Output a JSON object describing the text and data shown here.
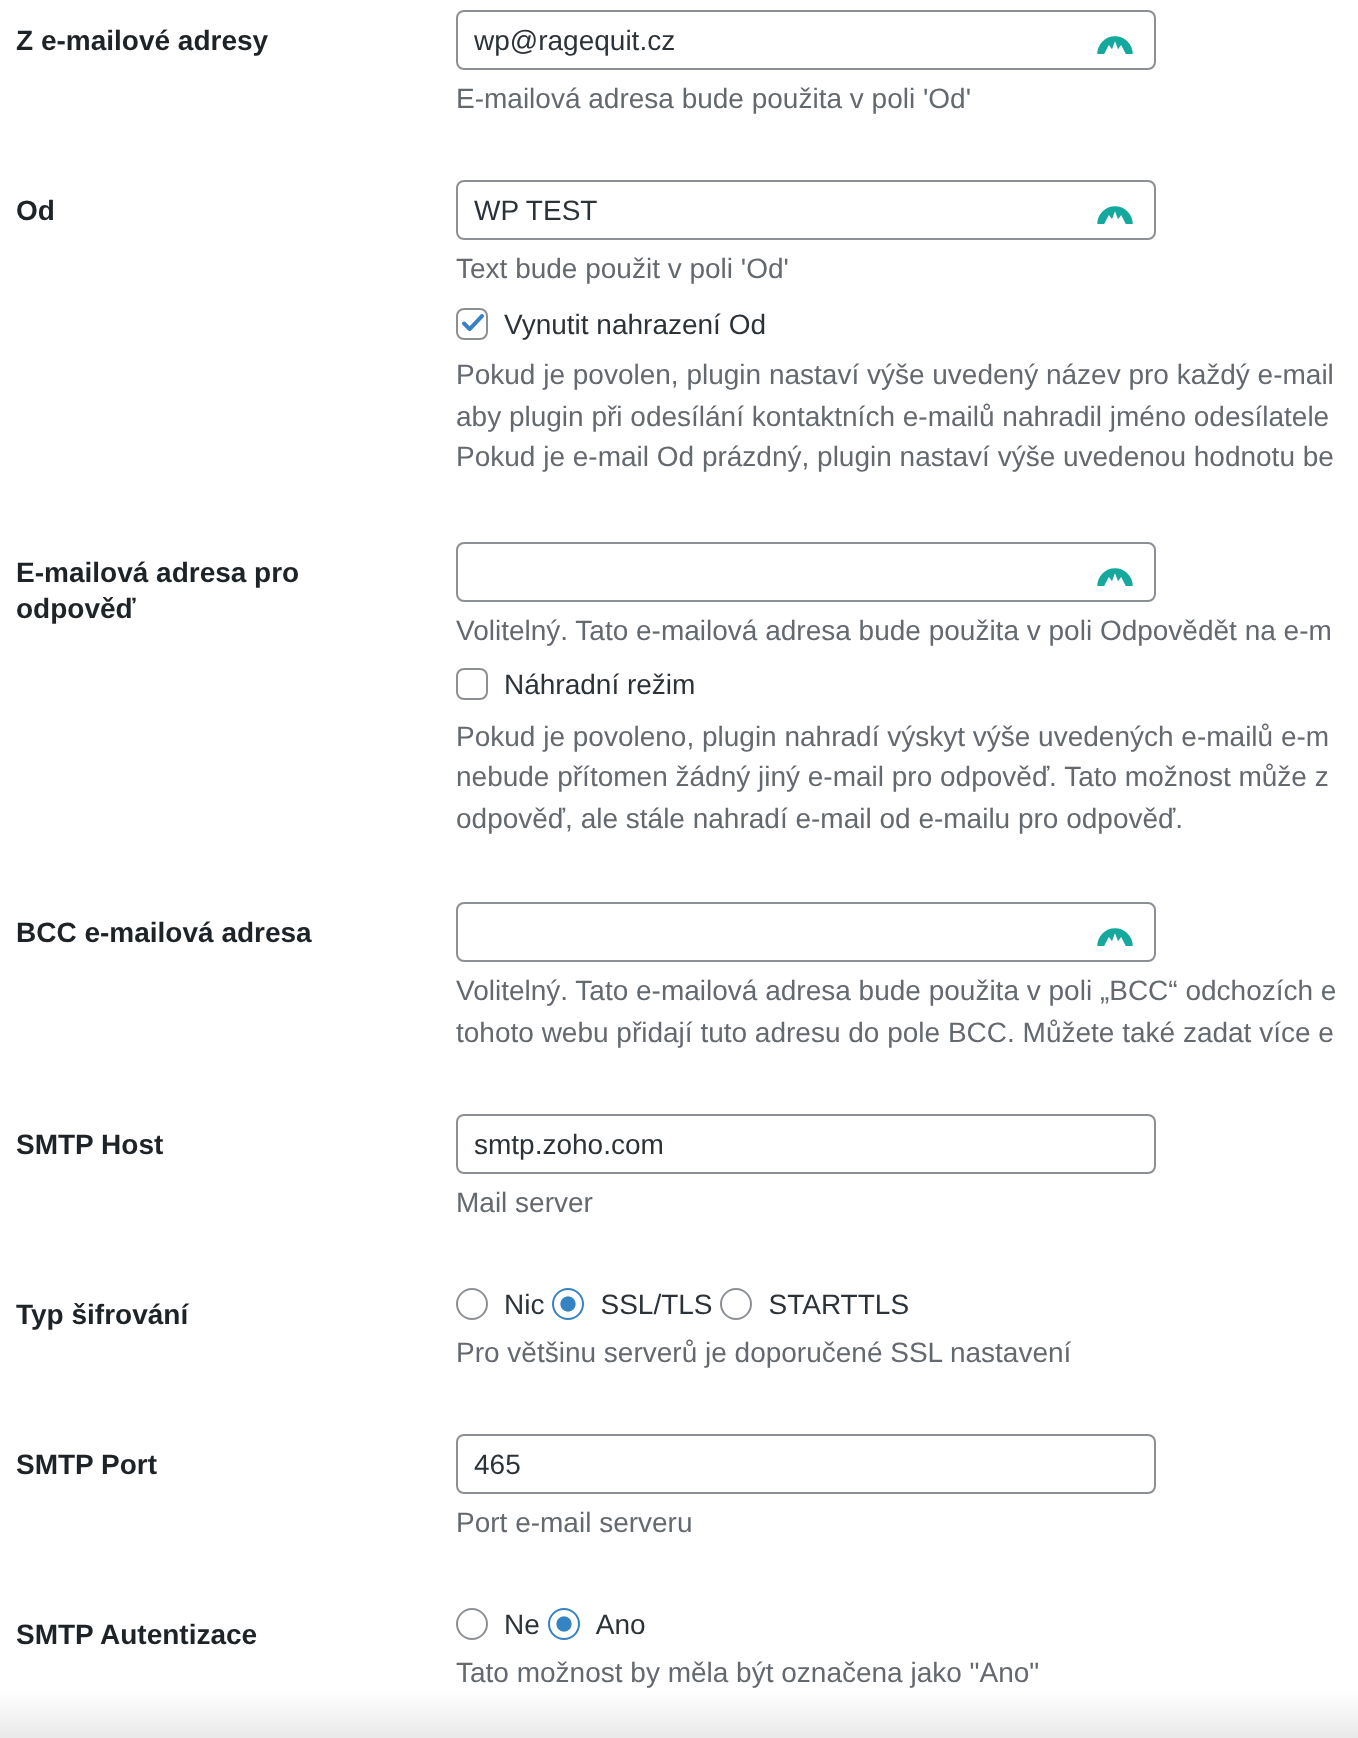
{
  "settings": [
    {
      "kind": "text",
      "label": "Z e-mailové adresy",
      "value": "wp@ragequit.cz",
      "icon": true,
      "description": [
        "E-mailová adresa bude použita v poli 'Od'"
      ]
    },
    {
      "kind": "text",
      "label": "Od",
      "value": "WP TEST",
      "icon": true,
      "description": [
        "Text bude použit v poli 'Od'"
      ],
      "option": {
        "label": "Vynutit nahrazení Od",
        "checked": true
      },
      "note": [
        "Pokud je povolen, plugin nastaví výše uvedený název pro každý e-mail",
        "aby plugin při odesílání kontaktních e-mailů nahradil jméno odesílatele",
        "Pokud je e-mail Od prázdný, plugin nastaví výše uvedenou hodnotu be"
      ]
    },
    {
      "kind": "text",
      "label": "E-mailová adresa pro odpověď",
      "icon": true,
      "description": [
        "Volitelný. Tato e-mailová adresa bude použita v poli Odpovědět na e-m"
      ],
      "option": {
        "label": "Náhradní režim",
        "checked": false
      },
      "note": [
        "Pokud je povoleno, plugin nahradí výskyt výše uvedených e-mailů e-m",
        "nebude přítomen žádný jiný e-mail pro odpověď. Tato možnost může z",
        "odpověď, ale stále nahradí e-mail od e-mailu pro odpověď."
      ]
    },
    {
      "kind": "text",
      "label": "BCC e-mailová adresa",
      "icon": true,
      "description": [
        "Volitelný. Tato e-mailová adresa bude použita v poli „BCC“ odchozích e",
        "tohoto webu přidají tuto adresu do pole BCC. Můžete také zadat více e"
      ]
    },
    {
      "kind": "text",
      "label": "SMTP Host",
      "value": "smtp.zoho.com",
      "icon": false,
      "description": [
        "Mail server"
      ]
    },
    {
      "kind": "radio",
      "label": "Typ šifrování",
      "options": [
        {
          "label": "Nic",
          "selected": false
        },
        {
          "label": "SSL/TLS",
          "selected": true
        },
        {
          "label": "STARTTLS",
          "selected": false
        }
      ],
      "description": [
        "Pro většinu serverů je doporučené SSL nastavení"
      ]
    },
    {
      "kind": "text",
      "label": "SMTP Port",
      "value": "465",
      "icon": false,
      "description": [
        "Port e-mail serveru"
      ]
    },
    {
      "kind": "radio",
      "label": "SMTP Autentizace",
      "options": [
        {
          "label": "Ne",
          "selected": false
        },
        {
          "label": "Ano",
          "selected": true
        }
      ],
      "description": [
        "Tato možnost by měla být označena jako \"Ano\""
      ]
    }
  ]
}
